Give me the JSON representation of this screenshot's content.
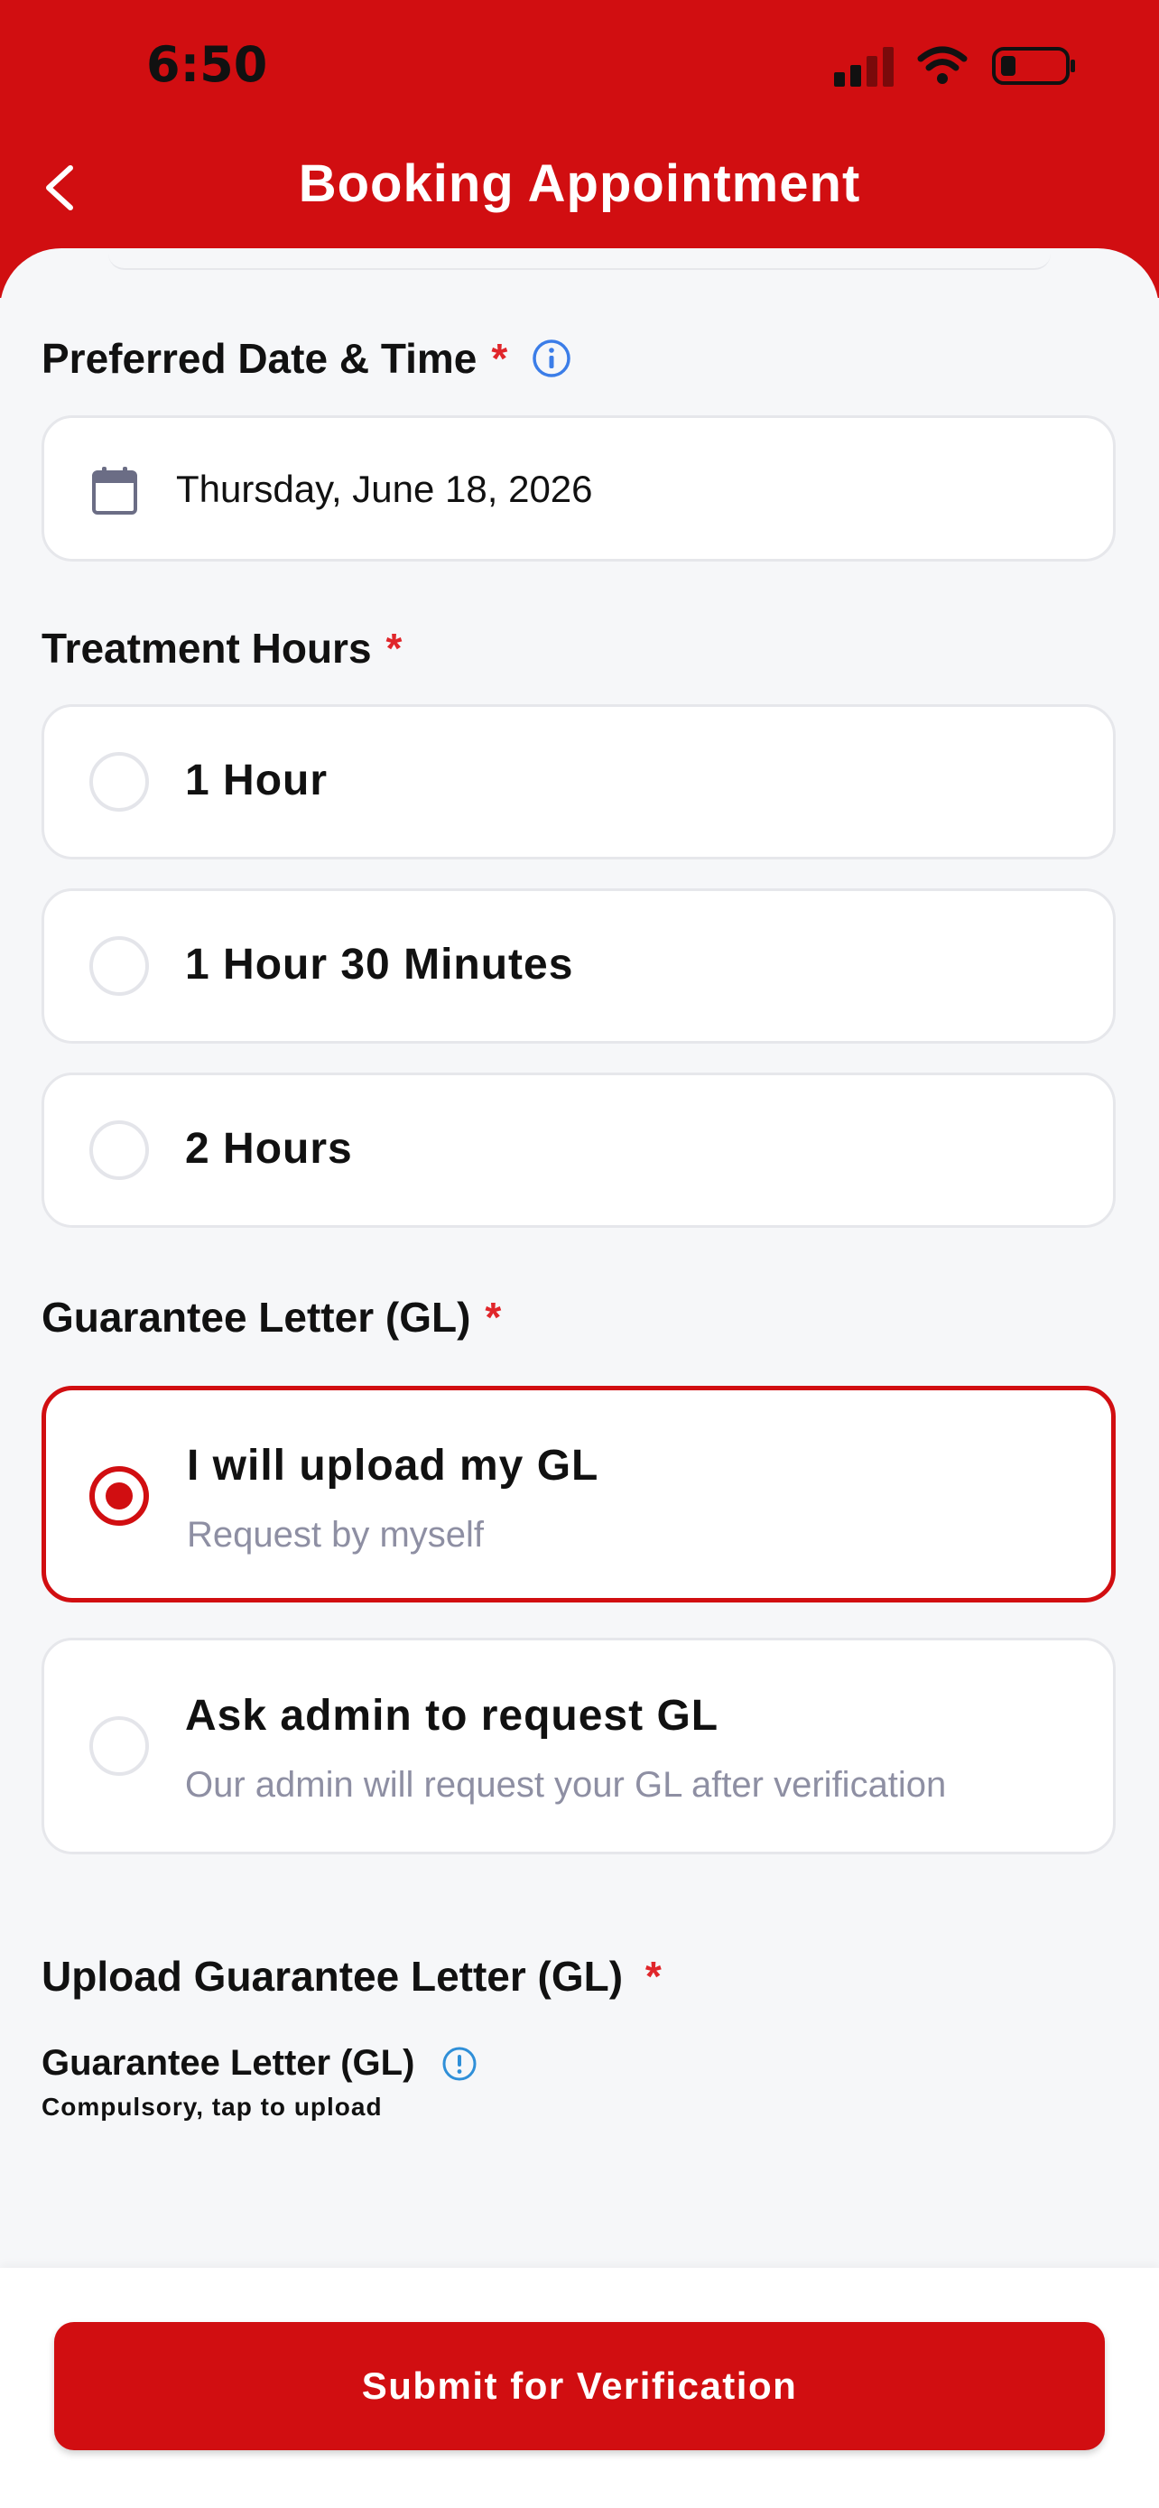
{
  "status_bar": {
    "time": "6:50"
  },
  "header": {
    "title": "Booking Appointment",
    "back_icon": "chevron-left-icon"
  },
  "preferred": {
    "label": "Preferred Date & Time",
    "required_mark": "*",
    "info_icon": "info-icon",
    "date_value": "Thursday, June 18, 2026",
    "calendar_icon": "calendar-icon"
  },
  "treatment": {
    "label": "Treatment Hours",
    "required_mark": "*",
    "options": [
      {
        "label": "1 Hour",
        "selected": false
      },
      {
        "label": "1 Hour 30 Minutes",
        "selected": false
      },
      {
        "label": "2 Hours",
        "selected": false
      }
    ]
  },
  "gl": {
    "label": "Guarantee Letter (GL)",
    "required_mark": "*",
    "options": [
      {
        "title": "I will upload my GL",
        "subtitle": "Request by myself",
        "selected": true
      },
      {
        "title": "Ask admin to request GL",
        "subtitle": "Our admin will request your GL after verification",
        "selected": false
      }
    ]
  },
  "upload": {
    "label": "Upload Guarantee Letter (GL)",
    "required_mark": "*",
    "field_label": "Guarantee Letter (GL)",
    "hint": "Compulsory, tap to upload",
    "alert_icon": "alert-circle-icon"
  },
  "footer": {
    "submit_label": "Submit for Verification"
  },
  "colors": {
    "brand": "#d10e11",
    "required": "#e0262b",
    "info": "#3b7de8",
    "muted": "#8e8fa3"
  }
}
